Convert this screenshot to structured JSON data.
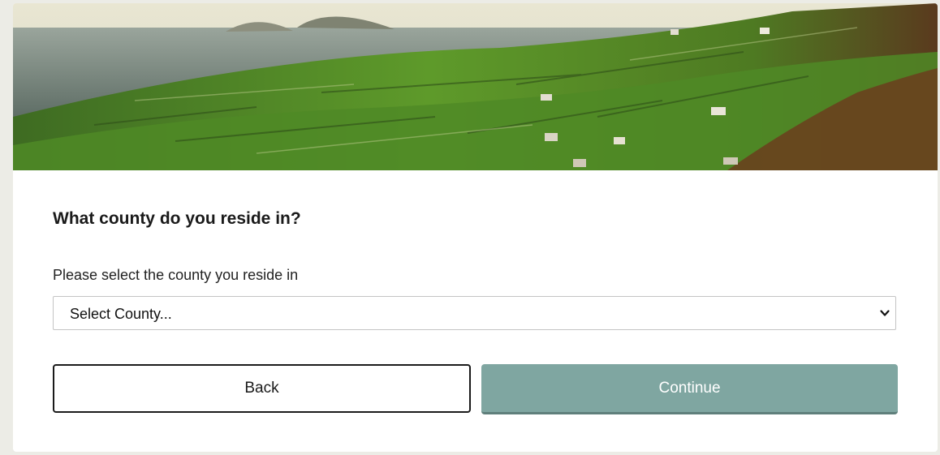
{
  "form": {
    "question": "What county do you reside in?",
    "field_label": "Please select the county you reside in",
    "select": {
      "selected_value": "Select County...",
      "icon": "chevron-down-icon"
    },
    "buttons": {
      "back_label": "Back",
      "continue_label": "Continue"
    }
  },
  "colors": {
    "page_background": "#ecece6",
    "card_background": "#ffffff",
    "continue_button": "#7fa6a1",
    "back_button_border": "#1a1a1a",
    "text": "#1a1a1a"
  }
}
